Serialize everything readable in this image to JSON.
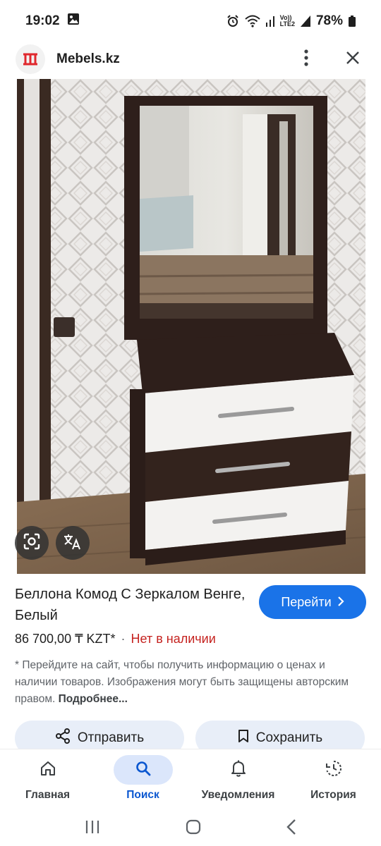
{
  "status_bar": {
    "time": "19:02",
    "volte_label": "Vo))",
    "lte_label": "LTE2",
    "battery": "78%"
  },
  "top_bar": {
    "site_name": "Mebels.kz"
  },
  "product": {
    "title": "Беллона Комод С Зеркалом Венге, Белый",
    "visit_label": "Перейти",
    "price": "86 700,00 ₸ KZT*",
    "separator": "·",
    "stock_status": "Нет в наличии",
    "disclaimer": "* Перейдите на сайт, чтобы получить информацию о ценах и наличии товаров. Изображения могут быть защищены авторским правом.",
    "more_label": "Подробнее..."
  },
  "actions": {
    "share_label": "Отправить",
    "save_label": "Сохранить"
  },
  "bottom_nav": {
    "items": [
      {
        "label": "Главная",
        "icon": "home-icon",
        "active": false
      },
      {
        "label": "Поиск",
        "icon": "search-icon",
        "active": true
      },
      {
        "label": "Уведомления",
        "icon": "bell-icon",
        "active": false
      },
      {
        "label": "История",
        "icon": "history-icon",
        "active": false
      }
    ]
  },
  "colors": {
    "accent": "#1a73e8",
    "active_nav": "#0b57d0",
    "active_nav_bg": "#dbe6fb",
    "out_of_stock": "#c5221f",
    "action_bg": "#e8eef8"
  }
}
